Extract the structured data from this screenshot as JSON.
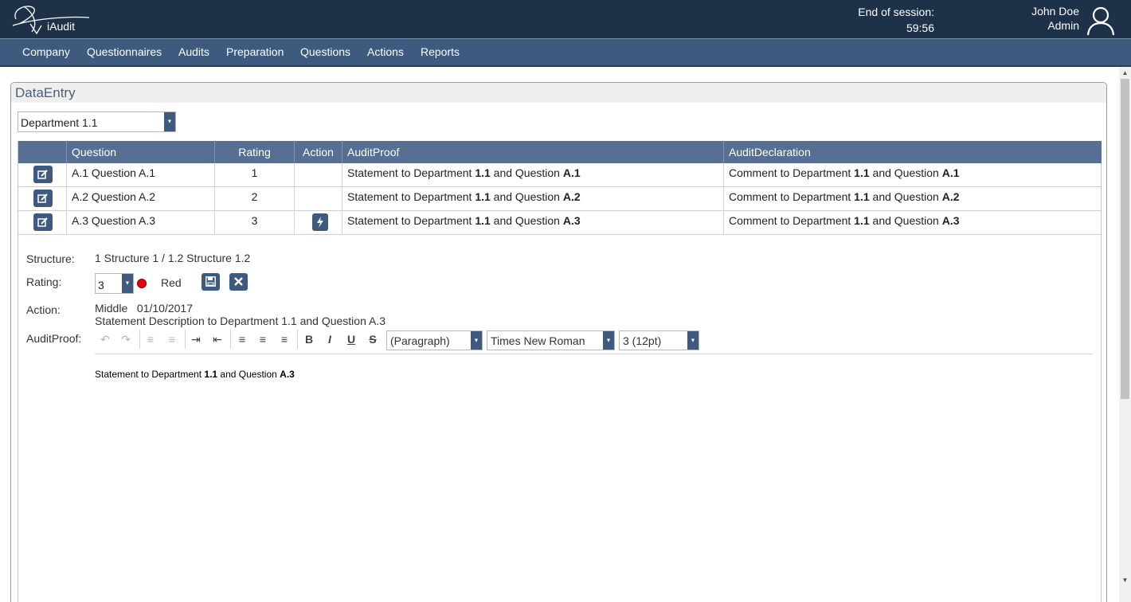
{
  "header": {
    "app_name": "iAudit",
    "session_label": "End of session:",
    "session_time": "59:56",
    "user_name": "John Doe",
    "user_role": "Admin"
  },
  "nav": [
    "Company",
    "Questionnaires",
    "Audits",
    "Preparation",
    "Questions",
    "Actions",
    "Reports"
  ],
  "panel": {
    "title": "DataEntry",
    "department": "Department 1.1"
  },
  "table": {
    "headers": [
      "Question",
      "Rating",
      "Action",
      "AuditProof",
      "AuditDeclaration"
    ],
    "rows": [
      {
        "question": "A.1 Question A.1",
        "rating": "1",
        "has_action": false,
        "proof_prefix": "Statement to Department ",
        "proof_dept": "1.1",
        "proof_mid": " and Question ",
        "proof_q": "A.1",
        "decl_prefix": "Comment to Department ",
        "decl_dept": "1.1",
        "decl_mid": " and Question ",
        "decl_q": "A.1"
      },
      {
        "question": "A.2 Question A.2",
        "rating": "2",
        "has_action": false,
        "proof_prefix": "Statement to Department ",
        "proof_dept": "1.1",
        "proof_mid": " and Question ",
        "proof_q": "A.2",
        "decl_prefix": "Comment to Department ",
        "decl_dept": "1.1",
        "decl_mid": " and Question ",
        "decl_q": "A.2"
      },
      {
        "question": "A.3 Question A.3",
        "rating": "3",
        "has_action": true,
        "proof_prefix": "Statement to Department ",
        "proof_dept": "1.1",
        "proof_mid": " and Question ",
        "proof_q": "A.3",
        "decl_prefix": "Comment to Department ",
        "decl_dept": "1.1",
        "decl_mid": " and Question ",
        "decl_q": "A.3"
      }
    ]
  },
  "detail": {
    "structure_label": "Structure:",
    "structure_value": "1 Structure 1 / 1.2 Structure 1.2",
    "rating_label": "Rating:",
    "rating_value": "3",
    "rating_color_name": "Red",
    "rating_color": "#e8000b",
    "action_label": "Action:",
    "action_priority": "Middle",
    "action_date": "01/10/2017",
    "action_description": "Statement Description to Department 1.1 and Question A.3",
    "proof_label": "AuditProof:",
    "editor": {
      "format": "(Paragraph)",
      "font": "Times New Roman",
      "size": "3 (12pt)",
      "bold_label": "B",
      "italic_label": "I",
      "underline_label": "U",
      "strike_label": "S",
      "text_prefix": "Statement to Department ",
      "text_dept": "1.1",
      "text_mid": " and Question ",
      "text_q": "A.3"
    }
  },
  "colors": {
    "header_bg": "#1d3149",
    "nav_bg": "#3e5a7e",
    "table_head_bg": "#566f92"
  }
}
